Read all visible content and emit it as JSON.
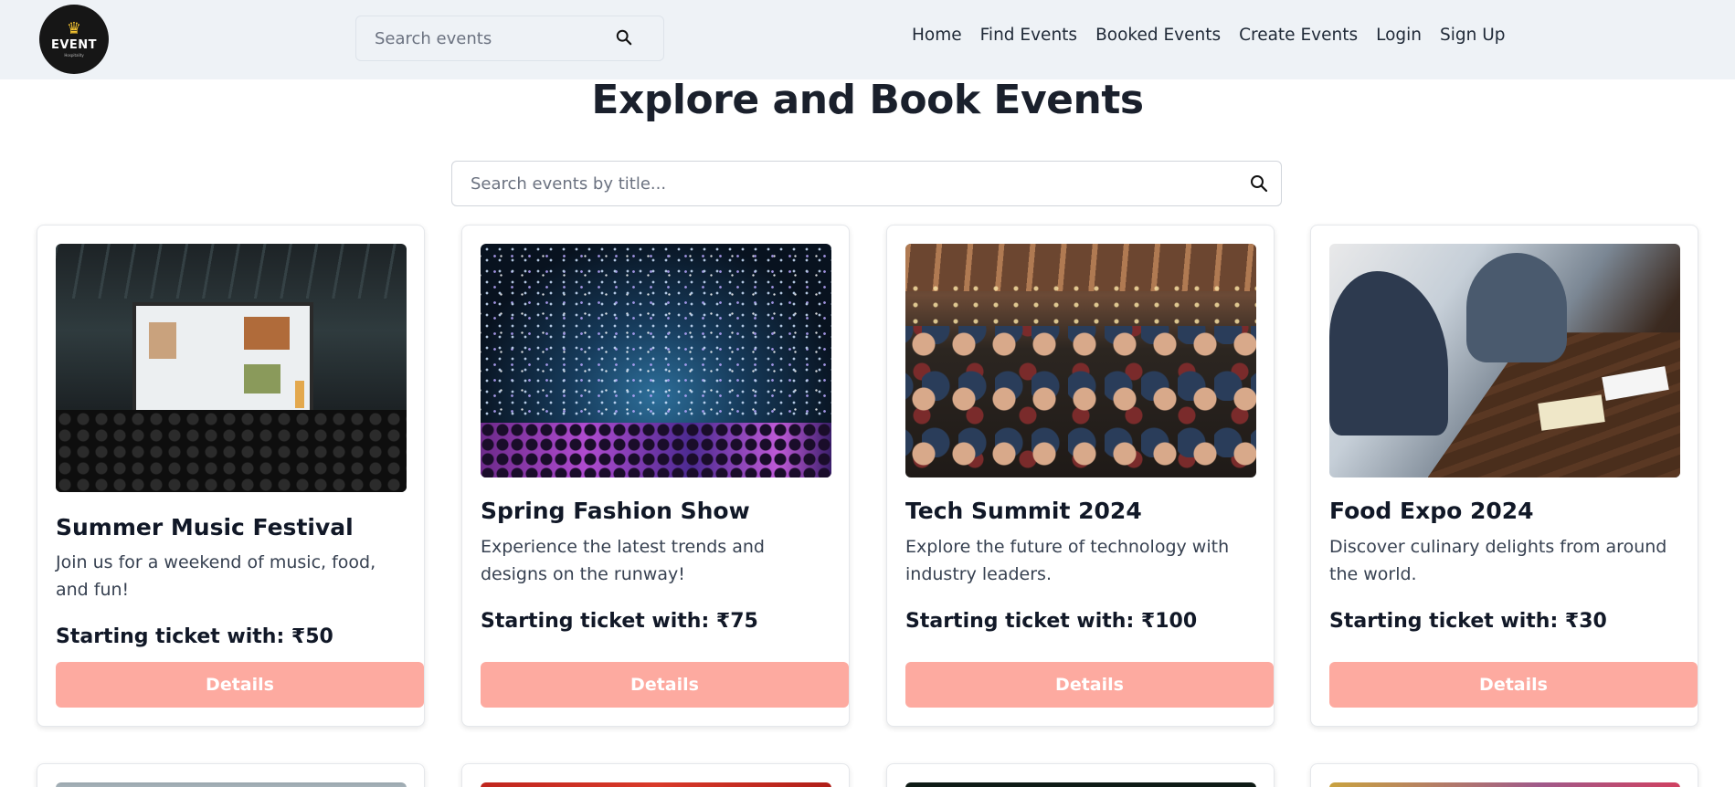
{
  "navbar": {
    "logo": {
      "text": "EVENT",
      "subtext": "Hospitality"
    },
    "search": {
      "placeholder": "Search events"
    },
    "links": [
      "Home",
      "Find Events",
      "Booked Events",
      "Create Events",
      "Login",
      "Sign Up"
    ]
  },
  "page": {
    "title": "Explore and Book Events",
    "search": {
      "placeholder": "Search events by title..."
    }
  },
  "events": [
    {
      "title": "Summer Music Festival",
      "description": "Join us for a weekend of music, food, and fun!",
      "price": "Starting ticket with: ₹50",
      "button": "Details"
    },
    {
      "title": "Spring Fashion Show",
      "description": "Experience the latest trends and designs on the runway!",
      "price": "Starting ticket with: ₹75",
      "button": "Details"
    },
    {
      "title": "Tech Summit 2024",
      "description": "Explore the future of technology with industry leaders.",
      "price": "Starting ticket with: ₹100",
      "button": "Details"
    },
    {
      "title": "Food Expo 2024",
      "description": "Discover culinary delights from around the world.",
      "price": "Starting ticket with: ₹30",
      "button": "Details"
    }
  ],
  "icons": {
    "search": "search-icon"
  },
  "colors": {
    "button": "#fdaaa0",
    "navbar_bg": "#eef2f6",
    "logo_bg": "#161616"
  }
}
